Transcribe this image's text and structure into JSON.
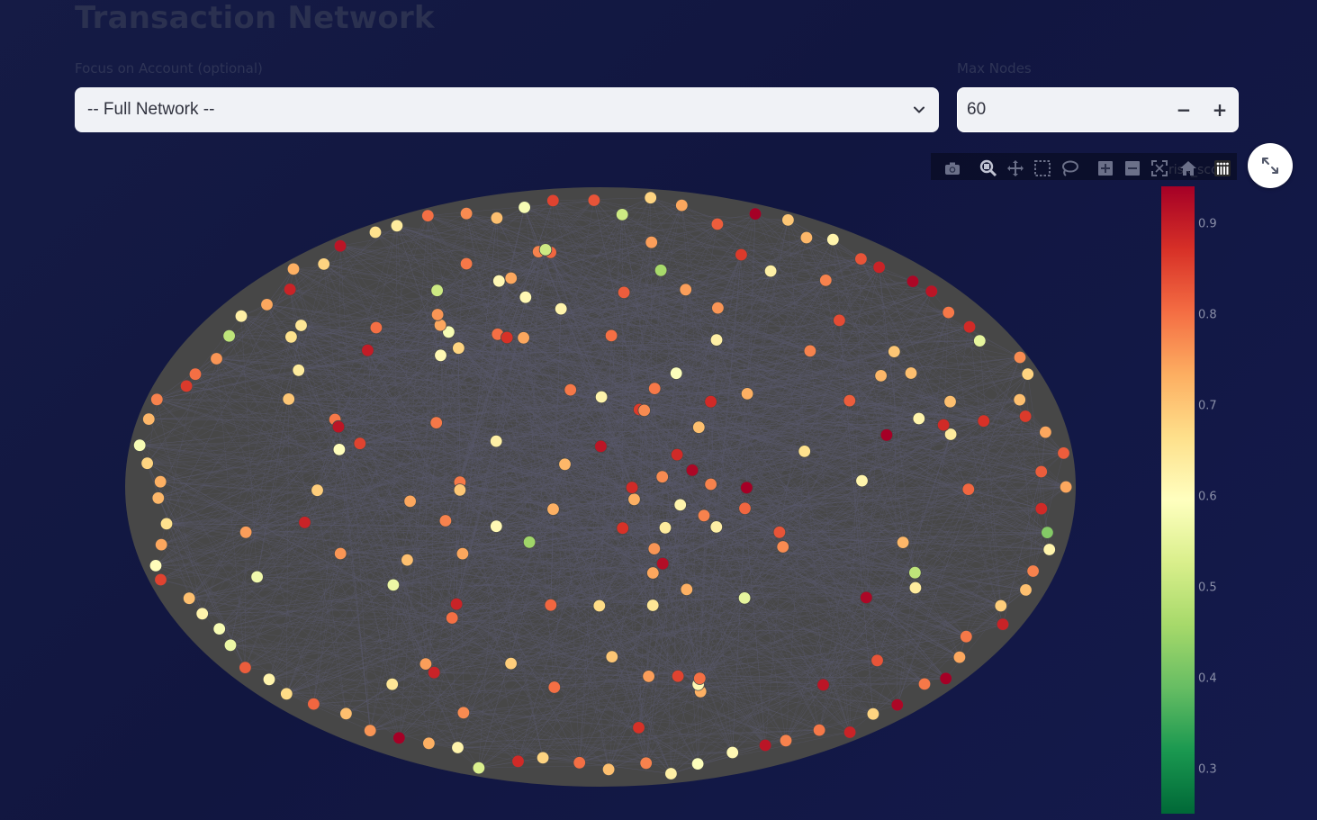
{
  "header": {
    "title": "Transaction Network"
  },
  "controls": {
    "account_label": "Focus on Account (optional)",
    "account_value": "-- Full Network --",
    "max_nodes_label": "Max Nodes",
    "max_nodes_value": "60",
    "minus_label": "−",
    "plus_label": "+"
  },
  "modebar": {
    "icons": [
      "camera-icon",
      "zoom-icon",
      "pan-icon",
      "box-select-icon",
      "lasso-icon",
      "zoom-in-icon",
      "zoom-out-icon",
      "autoscale-icon",
      "reset-axes-icon",
      "plotly-logo-icon"
    ]
  },
  "colors": {
    "graph_background": "#474747",
    "edge_color": "#5a5a6e",
    "colorscale": [
      "#006837",
      "#1a9850",
      "#66bd63",
      "#a6d96a",
      "#d9ef8b",
      "#ffffbf",
      "#fee08b",
      "#fdae61",
      "#f46d43",
      "#d73027",
      "#a50026"
    ]
  },
  "colorbar": {
    "title": "risk_sco",
    "ticks": [
      "0.9",
      "0.8",
      "0.7",
      "0.6",
      "0.5",
      "0.4",
      "0.3"
    ],
    "tick_values": [
      0.9,
      0.8,
      0.7,
      0.6,
      0.5,
      0.4,
      0.3
    ],
    "range": [
      0.25,
      0.94
    ]
  },
  "nodes": {
    "risk_scores": [
      0.74,
      0.88,
      0.42,
      0.62,
      0.78,
      0.71,
      0.69,
      0.89,
      0.79,
      0.74,
      0.94,
      0.79,
      0.93,
      0.68,
      0.89,
      0.79,
      0.78,
      0.91,
      0.61,
      0.59,
      0.63,
      0.78,
      0.71,
      0.8,
      0.68,
      0.88,
      0.53,
      0.62,
      0.73,
      0.94,
      0.76,
      0.71,
      0.81,
      0.67,
      0.62,
      0.82,
      0.56,
      0.58,
      0.62,
      0.71,
      0.85,
      0.6,
      0.74,
      0.66,
      0.72,
      0.73,
      0.68,
      0.58,
      0.72,
      0.78,
      0.86,
      0.8,
      0.76,
      0.49,
      0.63,
      0.74,
      0.89,
      0.73,
      0.68,
      0.91,
      0.66,
      0.64,
      0.8,
      0.77,
      0.71,
      0.58,
      0.85,
      0.83,
      0.51,
      0.68,
      0.74,
      0.82,
      0.94,
      0.7,
      0.72,
      0.62,
      0.83,
      0.89,
      0.93,
      0.91,
      0.79,
      0.88,
      0.55,
      0.77,
      0.68,
      0.71,
      0.86,
      0.74,
      0.82,
      0.82,
      0.78,
      0.58,
      0.79,
      0.8,
      0.91,
      0.69,
      0.73,
      0.81,
      0.68,
      0.64,
      0.63,
      0.72,
      0.77,
      0.82,
      0.78,
      0.81,
      0.63,
      0.73,
      0.66,
      0.74,
      0.61,
      0.7,
      0.62,
      0.51,
      0.56,
      0.83,
      0.86,
      0.91,
      0.79,
      0.85,
      0.76,
      0.8,
      0.91,
      0.78,
      0.71,
      0.88,
      0.61,
      0.87,
      0.46,
      0.57,
      0.64,
      0.74,
      0.8,
      0.69,
      0.7,
      0.76,
      0.81,
      0.78,
      0.76,
      0.87,
      0.45,
      0.65,
      0.74,
      0.88,
      0.65,
      0.86,
      0.71,
      0.8,
      0.6,
      0.78,
      0.73,
      0.8,
      0.74,
      0.79,
      0.7,
      0.75,
      0.71,
      0.77,
      0.94,
      0.73,
      0.79,
      0.73,
      0.62,
      0.92,
      0.72,
      0.76,
      0.62,
      0.89,
      0.94,
      0.64,
      0.61,
      0.63,
      0.72,
      0.75,
      0.67,
      0.9,
      0.59,
      0.88,
      0.87,
      0.75,
      0.77,
      0.82,
      0.63,
      0.84,
      0.51,
      0.88,
      0.79,
      0.83,
      0.93,
      0.77,
      0.71,
      0.66,
      0.87,
      0.89,
      0.55,
      0.74,
      0.62,
      0.93,
      0.75,
      0.62,
      0.74,
      0.65,
      0.75,
      0.61,
      0.79,
      0.49,
      0.61,
      0.85,
      0.7,
      0.78,
      0.89,
      0.8,
      0.64,
      0.81
    ]
  }
}
